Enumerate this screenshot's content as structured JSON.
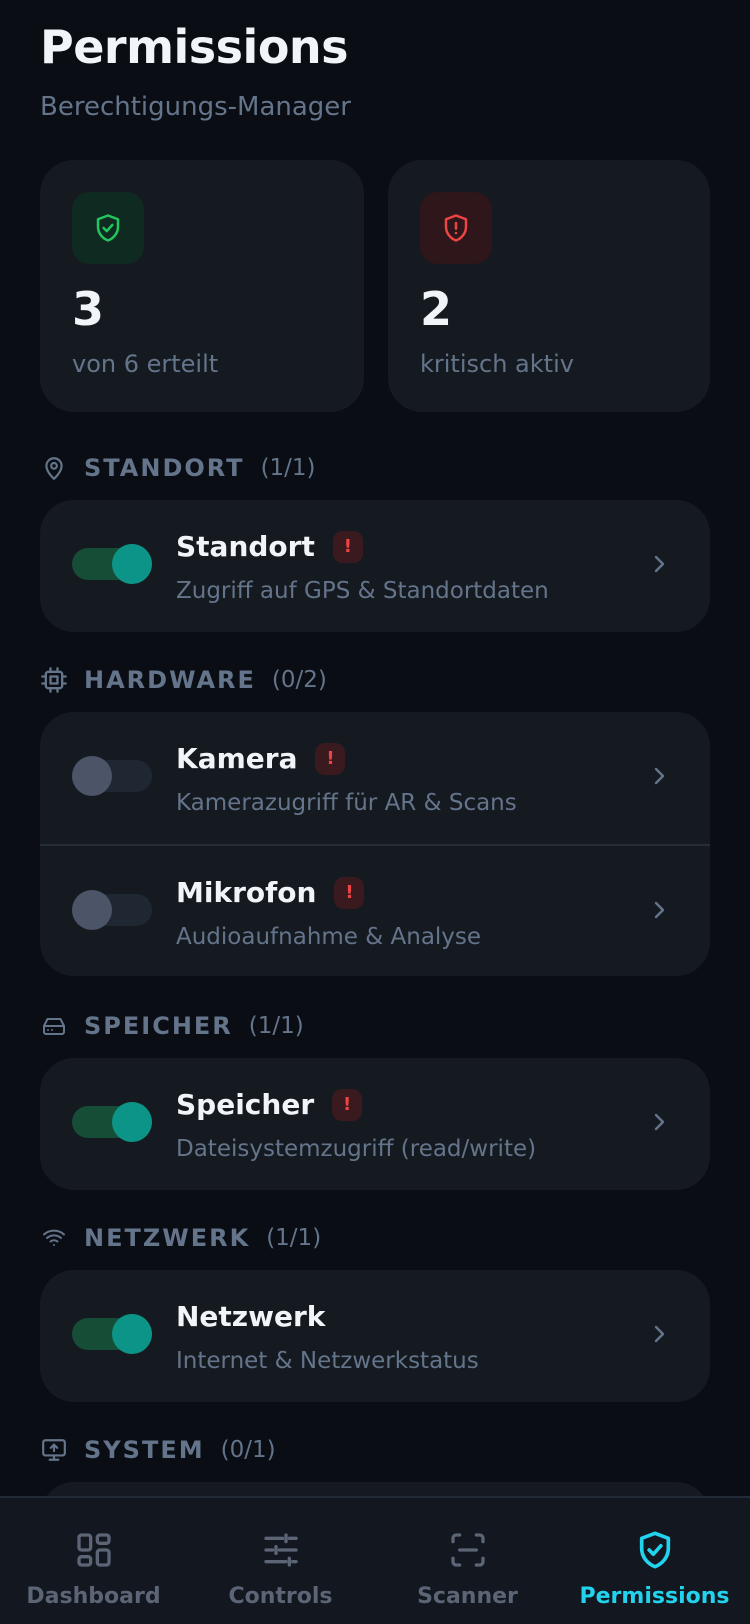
{
  "header": {
    "title": "Permissions",
    "subtitle": "Berechtigungs-Manager"
  },
  "stats": {
    "granted": {
      "value": "3",
      "label": "von 6 erteilt",
      "icon": "shield-check-icon",
      "color": "#22c55e"
    },
    "critical": {
      "value": "2",
      "label": "kritisch aktiv",
      "icon": "shield-alert-icon",
      "color": "#ef4444"
    }
  },
  "sections": {
    "standort": {
      "name": "STANDORT",
      "count": "(1/1)",
      "icon": "location-pin-icon",
      "items": [
        {
          "title": "Standort",
          "desc": "Zugriff auf GPS & Standortdaten",
          "enabled": true,
          "critical": true,
          "badge": "!"
        }
      ]
    },
    "hardware": {
      "name": "HARDWARE",
      "count": "(0/2)",
      "icon": "chip-icon",
      "items": [
        {
          "title": "Kamera",
          "desc": "Kamerazugriff für AR & Scans",
          "enabled": false,
          "critical": true,
          "badge": "!"
        },
        {
          "title": "Mikrofon",
          "desc": "Audioaufnahme & Analyse",
          "enabled": false,
          "critical": true,
          "badge": "!"
        }
      ]
    },
    "speicher": {
      "name": "SPEICHER",
      "count": "(1/1)",
      "icon": "hard-drive-icon",
      "items": [
        {
          "title": "Speicher",
          "desc": "Dateisystemzugriff (read/write)",
          "enabled": true,
          "critical": true,
          "badge": "!"
        }
      ]
    },
    "netzwerk": {
      "name": "NETZWERK",
      "count": "(1/1)",
      "icon": "wifi-icon",
      "items": [
        {
          "title": "Netzwerk",
          "desc": "Internet & Netzwerkstatus",
          "enabled": true,
          "critical": false
        }
      ]
    },
    "system": {
      "name": "SYSTEM",
      "count": "(0/1)",
      "icon": "monitor-icon"
    }
  },
  "tabs": [
    {
      "label": "Dashboard",
      "icon": "dashboard-icon",
      "active": false
    },
    {
      "label": "Controls",
      "icon": "sliders-icon",
      "active": false
    },
    {
      "label": "Scanner",
      "icon": "scan-icon",
      "active": false
    },
    {
      "label": "Permissions",
      "icon": "shield-check-icon",
      "active": true
    }
  ],
  "colors": {
    "background": "#0a0e14",
    "card": "#151a21",
    "accent": "#22d3ee",
    "toggle_on": "#0d9488",
    "critical": "#ef4444",
    "muted": "#64748b"
  }
}
